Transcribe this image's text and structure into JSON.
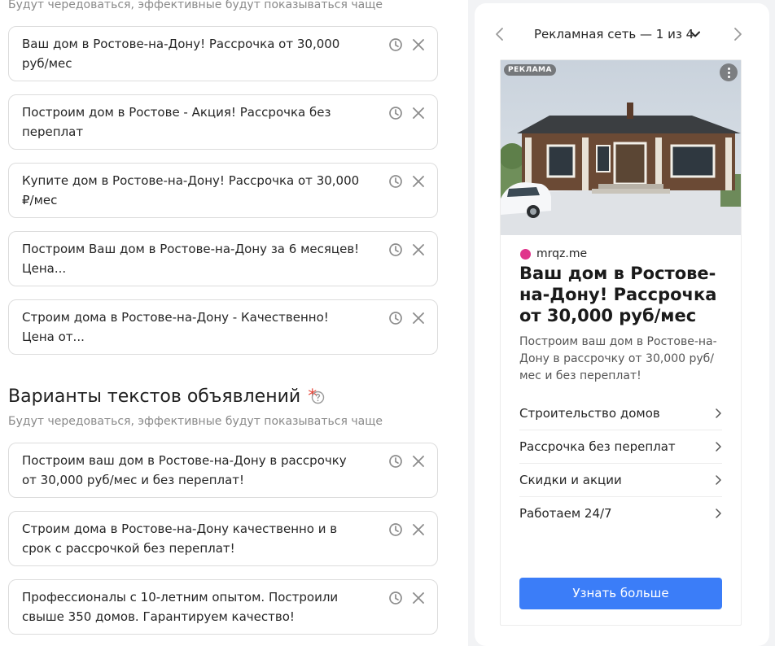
{
  "headlines": {
    "hint": "Будут чередоваться, эффективные будут показываться чаще",
    "items": [
      {
        "text": "Ваш дом в Ростове-на-Дону! Рассрочка от 30,000 руб/мес"
      },
      {
        "text": "Построим дом в Ростове - Акция! Рассрочка без переплат"
      },
      {
        "text": "Купите дом в Ростове-на-Дону! Рассрочка от 30,000 ₽/мес"
      },
      {
        "text": "Построим Ваш дом в Ростове-на-Дону за 6 месяцев! Цена..."
      },
      {
        "text": "Строим дома в Ростове-на-Дону - Качественно! Цена от..."
      }
    ]
  },
  "texts_section": {
    "title": "Варианты текстов объявлений",
    "required_mark": "*",
    "hint": "Будут чередоваться, эффективные будут показываться чаще",
    "items": [
      {
        "text": "Построим ваш дом в Ростове-на-Дону в рассрочку от 30,000 руб/мес и без переплат!"
      },
      {
        "text": "Строим дома в Ростове-на-Дону качественно и в срок с рассрочкой без переплат!"
      },
      {
        "text": "Профессионалы с 10-летним опытом. Построили свыше 350 домов. Гарантируем качество!"
      }
    ]
  },
  "preview": {
    "network_label": "Рекламная сеть — 1 из 4",
    "ad": {
      "badge": "РЕКЛАМА",
      "domain": "mrqz.me",
      "title": "Ваш дом в Ростове-на-Дону! Рассрочка от 30,000 руб/мес",
      "body": "Построим ваш дом в Ростове-на-Дону в рассрочку от 30,000 руб/мес и без переплат!",
      "sitelinks": [
        {
          "label": "Строительство домов"
        },
        {
          "label": "Рассрочка без переплат"
        },
        {
          "label": "Скидки и акции"
        },
        {
          "label": "Работаем 24/7"
        }
      ],
      "cta": "Узнать больше"
    }
  },
  "colors": {
    "accent": "#3b7df8",
    "required": "#e5473a",
    "domain_dot": "#e0338b"
  }
}
